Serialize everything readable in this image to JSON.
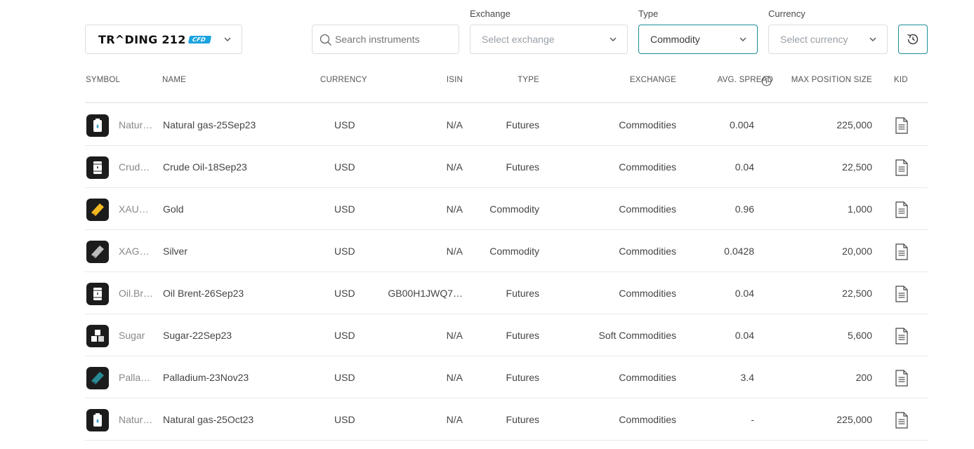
{
  "brand": {
    "name": "TR^DING 212",
    "badge": "CFD"
  },
  "filters": {
    "search_placeholder": "Search instruments",
    "exchange_label": "Exchange",
    "exchange_placeholder": "Select exchange",
    "type_label": "Type",
    "type_value": "Commodity",
    "currency_label": "Currency",
    "currency_placeholder": "Select currency"
  },
  "columns": {
    "symbol": "SYMBOL",
    "name": "NAME",
    "currency": "CURRENCY",
    "isin": "ISIN",
    "type": "TYPE",
    "exchange": "EXCHANGE",
    "spread": "AVG. SPREAD",
    "max_position": "MAX POSITION SIZE",
    "kid": "KID"
  },
  "rows": [
    {
      "symbol": "Natural gas",
      "name": "Natural gas-25Sep23",
      "currency": "USD",
      "isin": "N/A",
      "type": "Futures",
      "exchange": "Commodities",
      "spread": "0.004",
      "max_position": "225,000",
      "icon": "gas-icon",
      "icon_color": "#ffffff"
    },
    {
      "symbol": "Crude Oil",
      "name": "Crude Oil-18Sep23",
      "currency": "USD",
      "isin": "N/A",
      "type": "Futures",
      "exchange": "Commodities",
      "spread": "0.04",
      "max_position": "22,500",
      "icon": "oil-barrel-icon",
      "icon_color": "#ffffff"
    },
    {
      "symbol": "XAUUSD",
      "name": "Gold",
      "currency": "USD",
      "isin": "N/A",
      "type": "Commodity",
      "exchange": "Commodities",
      "spread": "0.96",
      "max_position": "1,000",
      "icon": "gold-bar-icon",
      "icon_color": "#f5b921"
    },
    {
      "symbol": "XAGUSD",
      "name": "Silver",
      "currency": "USD",
      "isin": "N/A",
      "type": "Commodity",
      "exchange": "Commodities",
      "spread": "0.0428",
      "max_position": "20,000",
      "icon": "silver-bar-icon",
      "icon_color": "#bdbdbd"
    },
    {
      "symbol": "Oil.Brent",
      "name": "Oil Brent-26Sep23",
      "currency": "USD",
      "isin": "GB00H1JWQ7…",
      "type": "Futures",
      "exchange": "Commodities",
      "spread": "0.04",
      "max_position": "22,500",
      "icon": "oil-barrel-icon",
      "icon_color": "#ffffff"
    },
    {
      "symbol": "Sugar",
      "name": "Sugar-22Sep23",
      "currency": "USD",
      "isin": "N/A",
      "type": "Futures",
      "exchange": "Soft Commodities",
      "spread": "0.04",
      "max_position": "5,600",
      "icon": "sugar-cubes-icon",
      "icon_color": "#ffffff"
    },
    {
      "symbol": "Palladium",
      "name": "Palladium-23Nov23",
      "currency": "USD",
      "isin": "N/A",
      "type": "Futures",
      "exchange": "Commodities",
      "spread": "3.4",
      "max_position": "200",
      "icon": "palladium-bar-icon",
      "icon_color": "#2a8a94"
    },
    {
      "symbol": "Natural gas",
      "name": "Natural gas-25Oct23",
      "currency": "USD",
      "isin": "N/A",
      "type": "Futures",
      "exchange": "Commodities",
      "spread": "-",
      "max_position": "225,000",
      "icon": "gas-icon",
      "icon_color": "#ffffff"
    }
  ]
}
